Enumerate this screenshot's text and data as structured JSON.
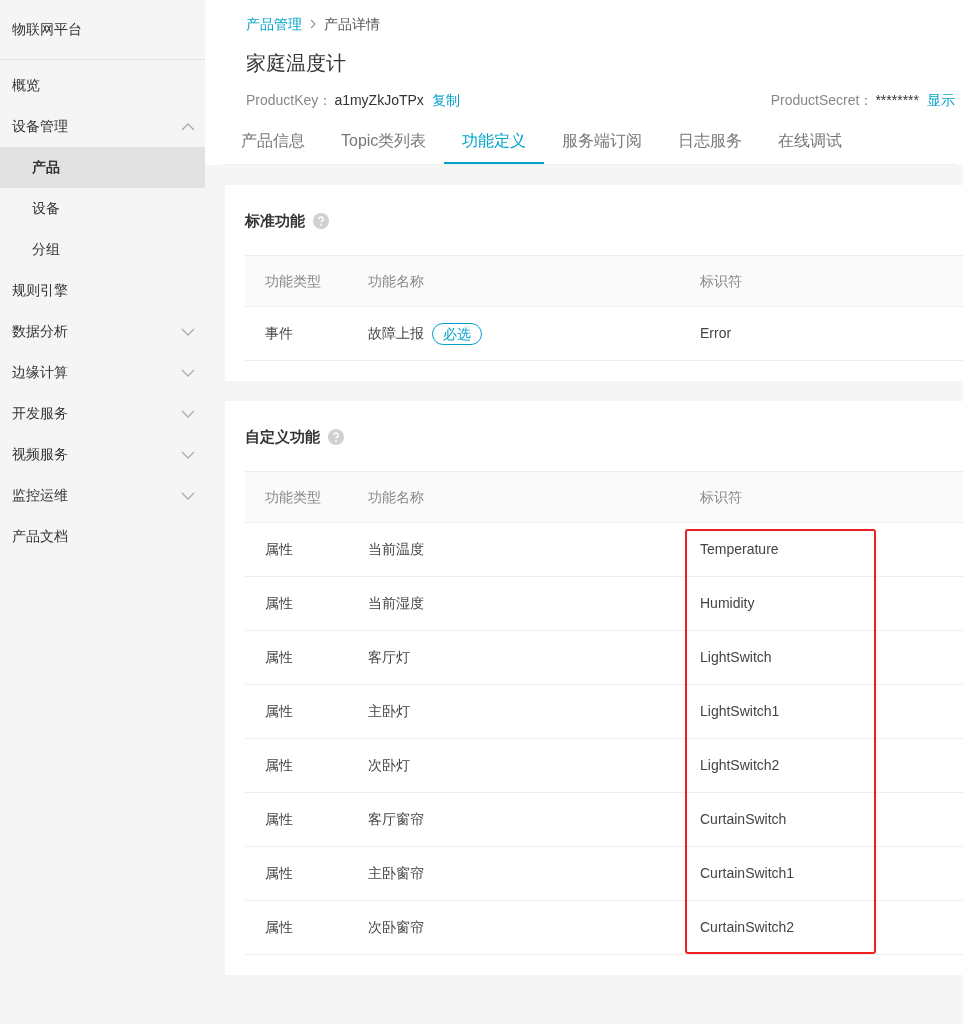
{
  "sidebar": {
    "title": "物联网平台",
    "items": [
      {
        "label": "概览",
        "selected": false
      },
      {
        "label": "设备管理",
        "selected": false,
        "expanded": true,
        "children": [
          {
            "label": "产品",
            "selected": true
          },
          {
            "label": "设备",
            "selected": false
          },
          {
            "label": "分组",
            "selected": false
          }
        ]
      },
      {
        "label": "规则引擎",
        "selected": false
      },
      {
        "label": "数据分析",
        "selected": false,
        "expanded": false
      },
      {
        "label": "边缘计算",
        "selected": false,
        "expanded": false
      },
      {
        "label": "开发服务",
        "selected": false,
        "expanded": false
      },
      {
        "label": "视频服务",
        "selected": false,
        "expanded": false
      },
      {
        "label": "监控运维",
        "selected": false,
        "expanded": false
      },
      {
        "label": "产品文档",
        "selected": false
      }
    ]
  },
  "breadcrumb": [
    {
      "label": "产品管理",
      "kind": "link"
    },
    {
      "label": "产品详情",
      "kind": "current"
    }
  ],
  "page_title": "家庭温度计",
  "product_key": {
    "label": "ProductKey：",
    "value": "a1myZkJoTPx",
    "action": "复制"
  },
  "product_secret": {
    "label": "ProductSecret：",
    "value": "********",
    "action": "显示"
  },
  "tabs": [
    {
      "label": "产品信息",
      "selected": false
    },
    {
      "label": "Topic类列表",
      "selected": false
    },
    {
      "label": "功能定义",
      "selected": true
    },
    {
      "label": "服务端订阅",
      "selected": false
    },
    {
      "label": "日志服务",
      "selected": false
    },
    {
      "label": "在线调试",
      "selected": false
    }
  ],
  "sections": [
    {
      "title": "标准功能",
      "columns": [
        "功能类型",
        "功能名称",
        "标识符"
      ],
      "highlighted": false,
      "rows": [
        {
          "type": "事件",
          "name": "故障上报",
          "badge": "必选",
          "identifier": "Error"
        }
      ]
    },
    {
      "title": "自定义功能",
      "columns": [
        "功能类型",
        "功能名称",
        "标识符"
      ],
      "highlighted": true,
      "rows": [
        {
          "type": "属性",
          "name": "当前温度",
          "identifier": "Temperature"
        },
        {
          "type": "属性",
          "name": "当前湿度",
          "identifier": "Humidity"
        },
        {
          "type": "属性",
          "name": "客厅灯",
          "identifier": "LightSwitch"
        },
        {
          "type": "属性",
          "name": "主卧灯",
          "identifier": "LightSwitch1"
        },
        {
          "type": "属性",
          "name": "次卧灯",
          "identifier": "LightSwitch2"
        },
        {
          "type": "属性",
          "name": "客厅窗帘",
          "identifier": "CurtainSwitch"
        },
        {
          "type": "属性",
          "name": "主卧窗帘",
          "identifier": "CurtainSwitch1"
        },
        {
          "type": "属性",
          "name": "次卧窗帘",
          "identifier": "CurtainSwitch2"
        }
      ]
    }
  ]
}
